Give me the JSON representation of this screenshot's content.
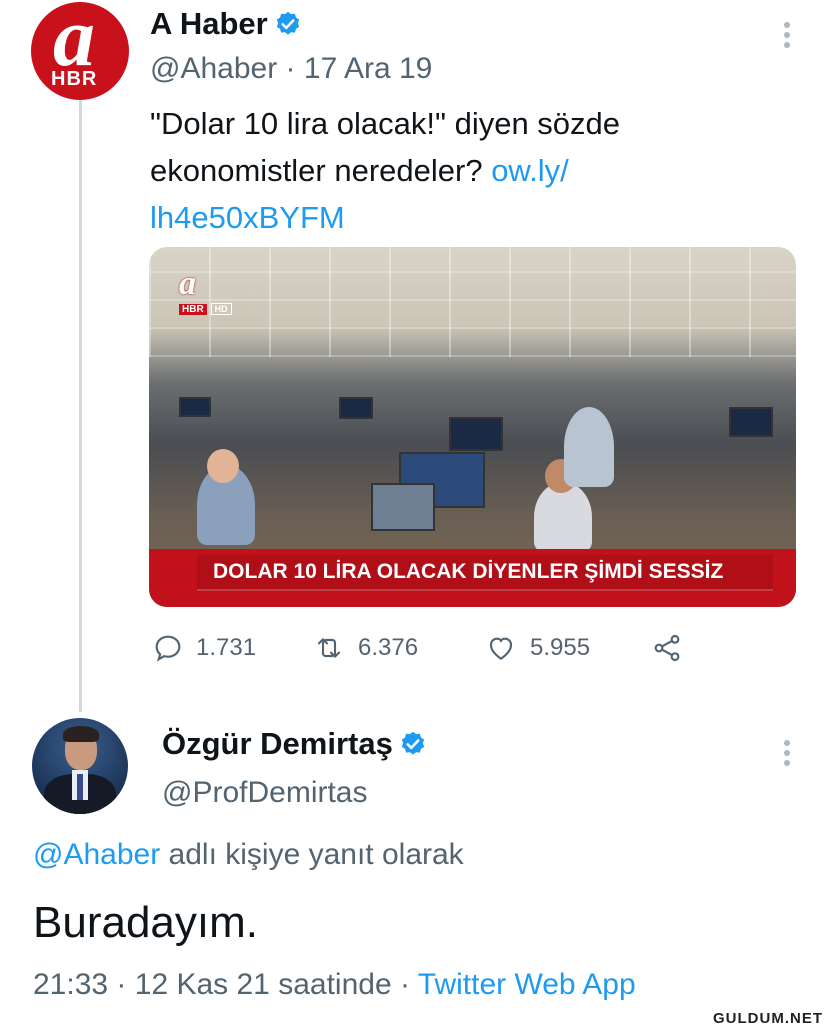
{
  "tweet": {
    "avatar_text": {
      "big": "a",
      "small": "HBR"
    },
    "name": "A Haber",
    "handle": "@Ahaber",
    "sep": "·",
    "date": "17 Ara 19",
    "text_before": "\"Dolar 10 lira olacak!\" diyen sözde ekonomistler neredeler? ",
    "link_line1": "ow.ly/",
    "link_line2": "lh4e50xBYFM",
    "media": {
      "logo": "a",
      "logo_small": "HBR",
      "logo_hd": "HD",
      "banner": "DOLAR 10 LİRA OLACAK DİYENLER ŞİMDİ SESSİZ"
    },
    "stats": {
      "replies": "1.731",
      "retweets": "6.376",
      "likes": "5.955"
    }
  },
  "reply": {
    "name": "Özgür Demirtaş",
    "handle": "@ProfDemirtas",
    "reply_to_handle": "@Ahaber",
    "reply_to_suffix": " adlı kişiye yanıt olarak",
    "text": "Buradayım.",
    "time": "21:33",
    "sep1": "·",
    "date": "12 Kas 21 saatinde",
    "sep2": "·",
    "source": "Twitter Web App"
  },
  "watermark": "GULDUM.NET",
  "colors": {
    "link": "#1d9bf0",
    "muted": "#536471",
    "verified": "#1d9bf0",
    "banner": "#c1121c"
  }
}
